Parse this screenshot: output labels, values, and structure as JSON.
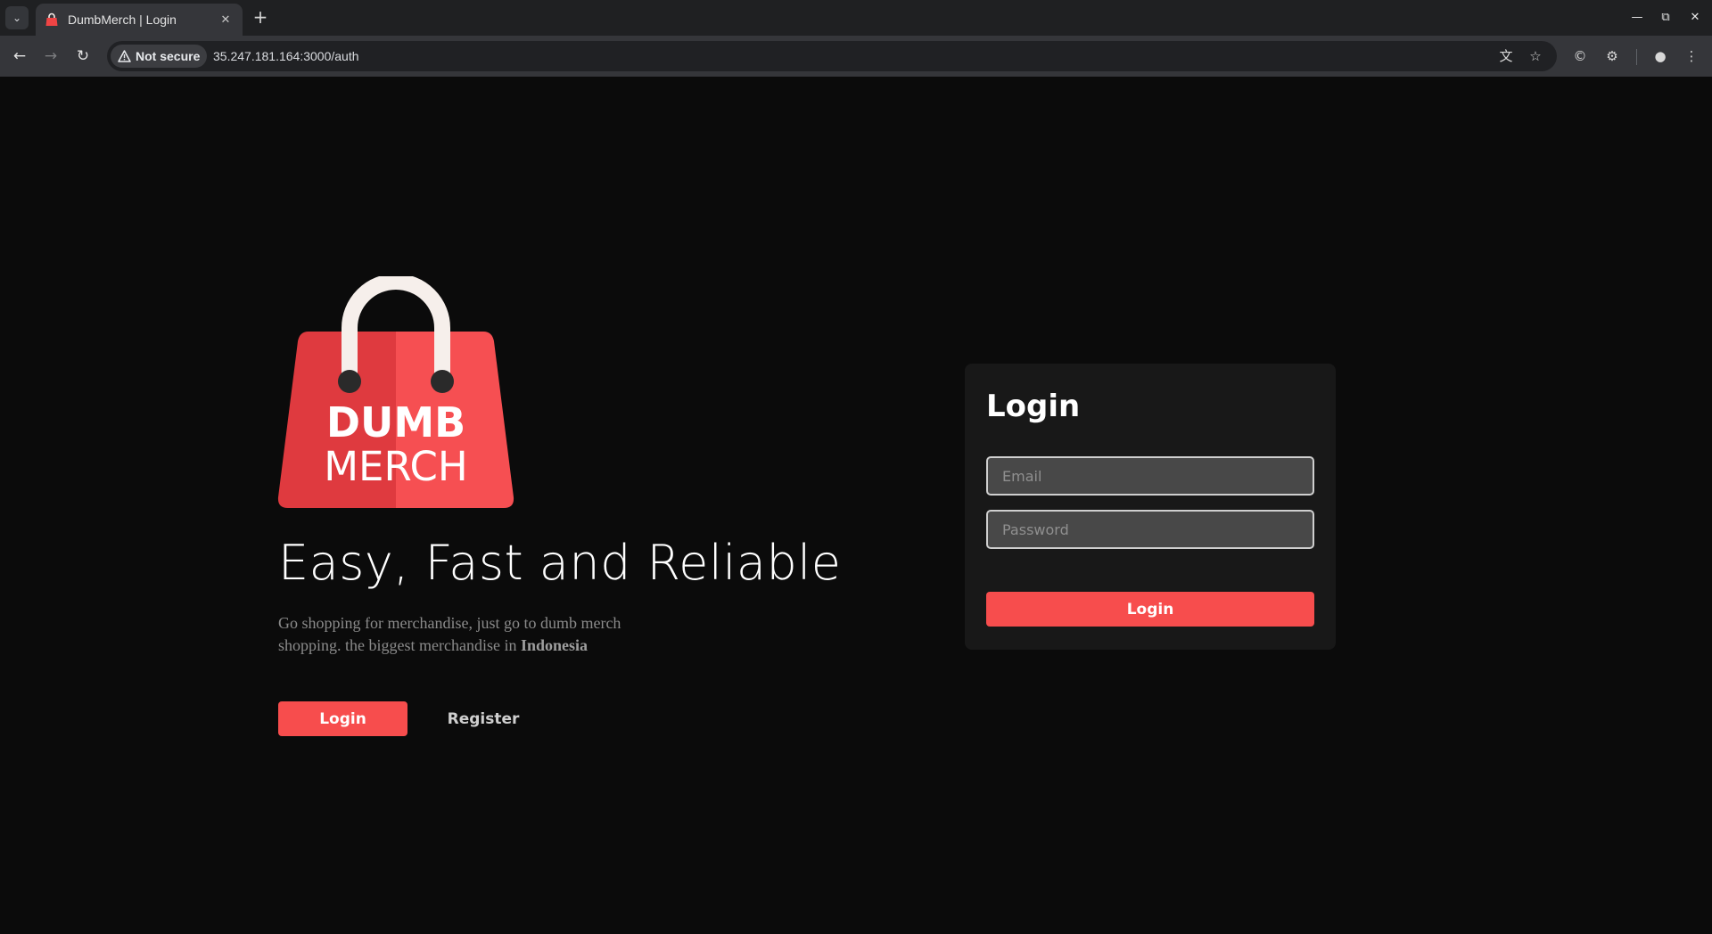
{
  "browser": {
    "tab_title": "DumbMerch | Login",
    "tab_close_icon": "close-icon",
    "security_label": "Not secure",
    "url": "35.247.181.164:3000/auth"
  },
  "brand": {
    "logo_line1": "DUMB",
    "logo_line2": "MERCH",
    "accent_color": "#f74d4d"
  },
  "hero": {
    "headline": "Easy, Fast and Reliable",
    "tagline_text": "Go shopping for merchandise, just go to dumb merch shopping. the biggest merchandise in ",
    "tagline_bold": "Indonesia",
    "login_button": "Login",
    "register_button": "Register"
  },
  "login_form": {
    "title": "Login",
    "email_placeholder": "Email",
    "password_placeholder": "Password",
    "submit_button": "Login"
  }
}
